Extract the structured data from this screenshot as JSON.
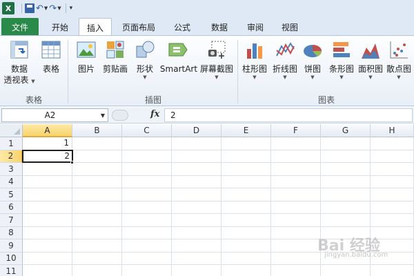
{
  "qat": {
    "excel_letter": "X"
  },
  "tabs": [
    {
      "label": "文件",
      "name": "tab-file"
    },
    {
      "label": "开始",
      "name": "tab-home"
    },
    {
      "label": "插入",
      "name": "tab-insert"
    },
    {
      "label": "页面布局",
      "name": "tab-page-layout"
    },
    {
      "label": "公式",
      "name": "tab-formulas"
    },
    {
      "label": "数据",
      "name": "tab-data"
    },
    {
      "label": "审阅",
      "name": "tab-review"
    },
    {
      "label": "视图",
      "name": "tab-view"
    }
  ],
  "active_tab": "插入",
  "ribbon": {
    "pivot_line1": "数据",
    "pivot_line2": "透视表",
    "table": "表格",
    "picture": "图片",
    "clipart": "剪贴画",
    "shapes": "形状",
    "smartart": "SmartArt",
    "screenshot": "屏幕截图",
    "column_chart": "柱形图",
    "line_chart": "折线图",
    "pie_chart": "饼图",
    "bar_chart": "条形图",
    "area_chart": "面积图",
    "scatter_chart": "散点图",
    "group_tables": "表格",
    "group_illustrations": "插图",
    "group_charts": "图表"
  },
  "formula_bar": {
    "name_box": "A2",
    "fx": "fx",
    "value": "2"
  },
  "columns": [
    "A",
    "B",
    "C",
    "D",
    "E",
    "F",
    "G",
    "H"
  ],
  "rows": [
    "1",
    "2",
    "3",
    "4",
    "5",
    "6",
    "7",
    "8",
    "9",
    "10",
    "11"
  ],
  "cells": {
    "A1": "1",
    "A2": "2"
  },
  "selected_cell": "A2",
  "watermark": {
    "text": "Bai 经验",
    "sub": "jingyan.baidu.com"
  },
  "colors": {
    "file_tab": "#2a8a4a",
    "selection_header": "#f7d36b",
    "ribbon_bg": "#e8eef7"
  }
}
